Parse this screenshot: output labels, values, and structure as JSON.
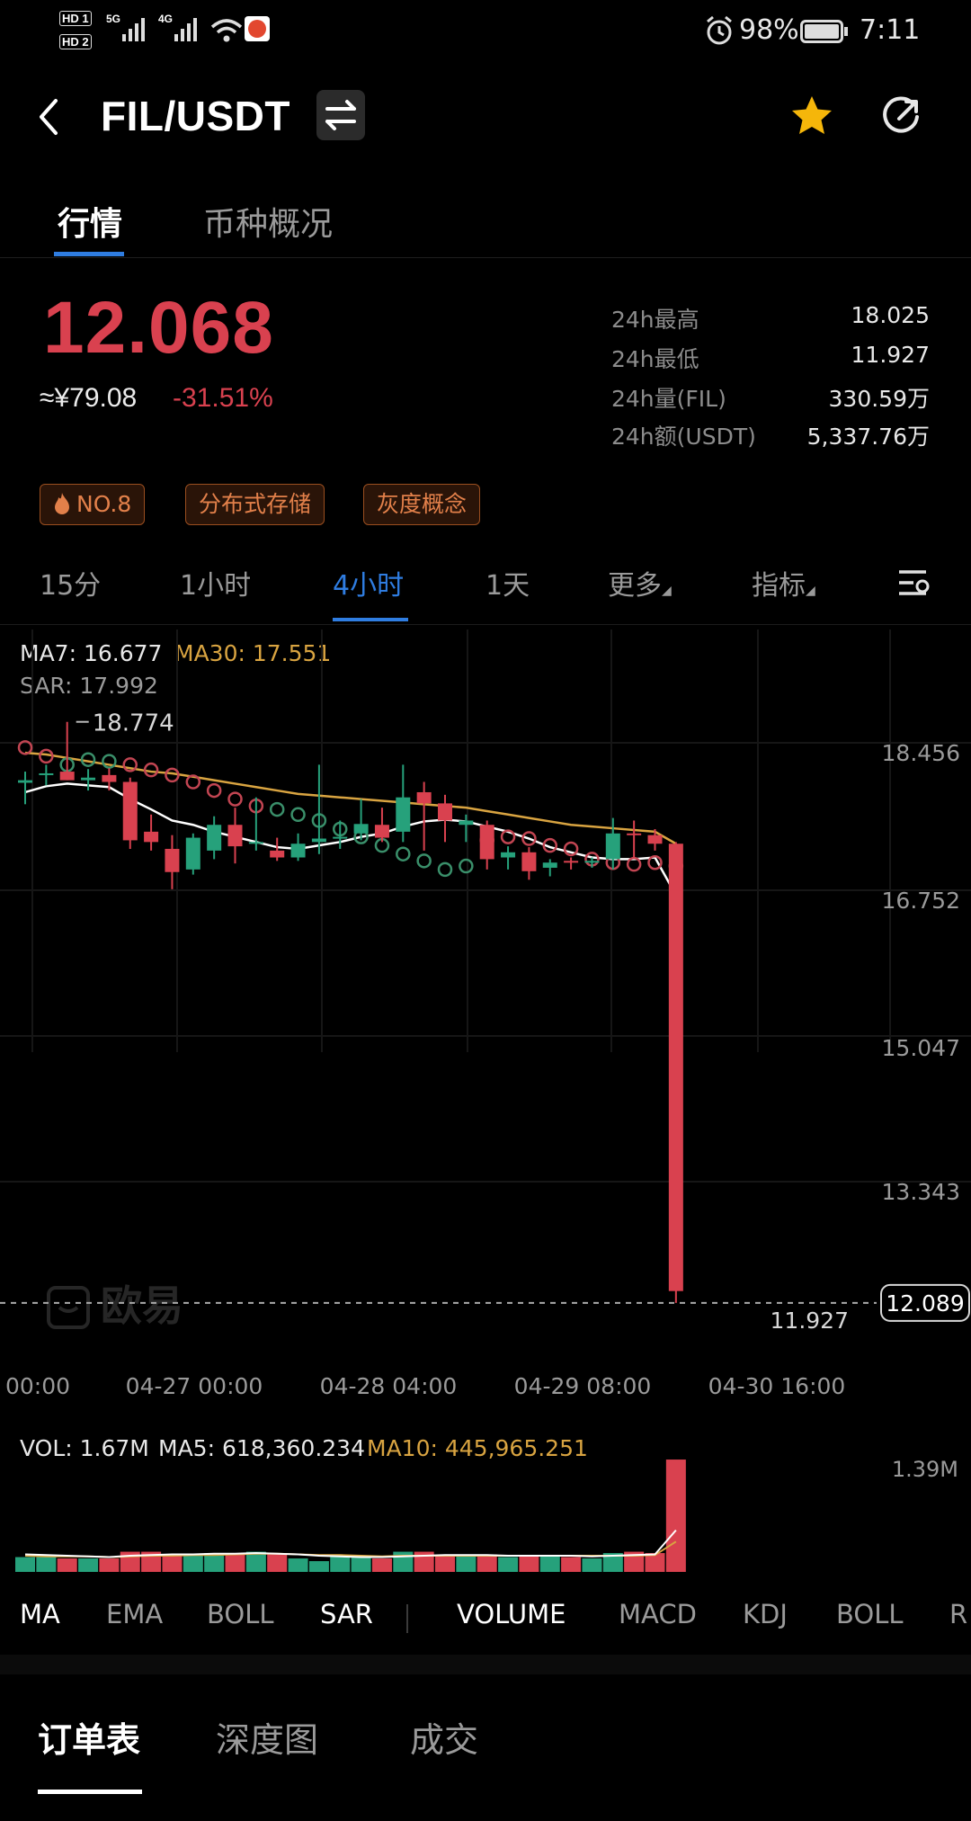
{
  "status_bar": {
    "sim1": "HD 1",
    "sim2": "HD 2",
    "net1": "5G",
    "net2": "4G",
    "battery": "98%",
    "time": "7:11",
    "icons": [
      "signal-icon",
      "wifi-icon",
      "app-notification-icon",
      "alarm-icon",
      "battery-icon"
    ]
  },
  "header": {
    "pair": "FIL/USDT",
    "icons": [
      "back-icon",
      "swap-icon",
      "star-icon",
      "share-icon"
    ]
  },
  "page_tabs": [
    {
      "label": "行情",
      "active": true
    },
    {
      "label": "币种概况",
      "active": false
    }
  ],
  "ticker": {
    "price": "12.068",
    "cny": "≈¥79.08",
    "change": "-31.51%"
  },
  "stats": [
    {
      "label": "24h最高",
      "value": "18.025"
    },
    {
      "label": "24h最低",
      "value": "11.927"
    },
    {
      "label": "24h量(FIL)",
      "value": "330.59万"
    },
    {
      "label": "24h额(USDT)",
      "value": "5,337.76万"
    }
  ],
  "tags": [
    "NO.8",
    "分布式存储",
    "灰度概念"
  ],
  "timeframes": [
    {
      "label": "15分"
    },
    {
      "label": "1小时"
    },
    {
      "label": "4小时",
      "active": true
    },
    {
      "label": "1天"
    },
    {
      "label": "更多"
    },
    {
      "label": "指标"
    }
  ],
  "indicators_top": {
    "ma7": "MA7: 16.677",
    "ma30": "MA30: 17.551",
    "sar": "SAR: 17.992"
  },
  "indicators_vol": {
    "vol": "VOL: 1.67M",
    "ma5": "MA5: 618,360.234",
    "ma10": "MA10: 445,965.251"
  },
  "indicator_tabs": [
    "MA",
    "EMA",
    "BOLL",
    "SAR",
    "VOLUME",
    "MACD",
    "KDJ",
    "BOLL",
    "R"
  ],
  "bottom_tabs": [
    "订单表",
    "深度图",
    "成交"
  ],
  "watermark": "欧易",
  "colors": {
    "up": "#26a17b",
    "down": "#d9414f",
    "accent": "#2f7de1",
    "ma30": "#d9a441",
    "ma7": "#ffffff"
  },
  "chart_data": {
    "type": "candlestick",
    "y_ticks": [
      "18.456",
      "16.752",
      "15.047",
      "13.343"
    ],
    "ylim": [
      11.9,
      18.85
    ],
    "x_ticks": [
      "00:00",
      "04-27 00:00",
      "04-28 04:00",
      "04-29 08:00",
      "04-30 16:00"
    ],
    "max_label": "18.774",
    "min_label": "11.927",
    "last_price_label": "12.089",
    "candles": [
      {
        "o": 17.99,
        "h": 18.12,
        "l": 17.74,
        "c": 18.02
      },
      {
        "o": 18.08,
        "h": 18.2,
        "l": 17.96,
        "c": 18.1
      },
      {
        "o": 18.12,
        "h": 18.7,
        "l": 18.02,
        "c": 18.02
      },
      {
        "o": 18.02,
        "h": 18.15,
        "l": 17.9,
        "c": 18.05
      },
      {
        "o": 18.08,
        "h": 18.16,
        "l": 17.9,
        "c": 18.0
      },
      {
        "o": 18.0,
        "h": 18.05,
        "l": 17.22,
        "c": 17.32
      },
      {
        "o": 17.42,
        "h": 17.62,
        "l": 17.2,
        "c": 17.3
      },
      {
        "o": 17.22,
        "h": 17.38,
        "l": 16.75,
        "c": 16.95
      },
      {
        "o": 16.98,
        "h": 17.4,
        "l": 16.92,
        "c": 17.35
      },
      {
        "o": 17.2,
        "h": 17.6,
        "l": 17.1,
        "c": 17.5
      },
      {
        "o": 17.5,
        "h": 17.7,
        "l": 17.05,
        "c": 17.25
      },
      {
        "o": 17.3,
        "h": 17.82,
        "l": 17.2,
        "c": 17.3
      },
      {
        "o": 17.2,
        "h": 17.35,
        "l": 17.08,
        "c": 17.12
      },
      {
        "o": 17.12,
        "h": 17.4,
        "l": 17.08,
        "c": 17.28
      },
      {
        "o": 17.3,
        "h": 18.2,
        "l": 17.16,
        "c": 17.34
      },
      {
        "o": 17.34,
        "h": 17.55,
        "l": 17.22,
        "c": 17.36
      },
      {
        "o": 17.4,
        "h": 17.8,
        "l": 17.32,
        "c": 17.51
      },
      {
        "o": 17.5,
        "h": 17.7,
        "l": 17.3,
        "c": 17.35
      },
      {
        "o": 17.42,
        "h": 18.2,
        "l": 17.3,
        "c": 17.82
      },
      {
        "o": 17.88,
        "h": 18.0,
        "l": 17.2,
        "c": 17.75
      },
      {
        "o": 17.75,
        "h": 17.85,
        "l": 17.3,
        "c": 17.55
      },
      {
        "o": 17.5,
        "h": 17.62,
        "l": 17.3,
        "c": 17.55
      },
      {
        "o": 17.5,
        "h": 17.55,
        "l": 16.98,
        "c": 17.1
      },
      {
        "o": 17.12,
        "h": 17.25,
        "l": 16.98,
        "c": 17.18
      },
      {
        "o": 17.18,
        "h": 17.24,
        "l": 16.86,
        "c": 16.96
      },
      {
        "o": 17.0,
        "h": 17.1,
        "l": 16.9,
        "c": 17.06
      },
      {
        "o": 17.08,
        "h": 17.12,
        "l": 16.98,
        "c": 17.06
      },
      {
        "o": 17.06,
        "h": 17.12,
        "l": 17.0,
        "c": 17.08
      },
      {
        "o": 17.1,
        "h": 17.58,
        "l": 16.98,
        "c": 17.4
      },
      {
        "o": 17.4,
        "h": 17.55,
        "l": 17.1,
        "c": 17.38
      },
      {
        "o": 17.38,
        "h": 17.45,
        "l": 17.2,
        "c": 17.28
      },
      {
        "o": 17.28,
        "h": 17.3,
        "l": 11.93,
        "c": 12.068
      }
    ],
    "ma7": [
      17.88,
      17.95,
      17.98,
      17.96,
      17.94,
      17.8,
      17.68,
      17.55,
      17.5,
      17.42,
      17.36,
      17.3,
      17.24,
      17.22,
      17.26,
      17.3,
      17.36,
      17.4,
      17.48,
      17.54,
      17.56,
      17.54,
      17.48,
      17.42,
      17.34,
      17.24,
      17.18,
      17.12,
      17.1,
      17.1,
      17.12,
      16.68
    ],
    "ma30": [
      18.34,
      18.32,
      18.28,
      18.24,
      18.2,
      18.16,
      18.12,
      18.1,
      18.06,
      18.02,
      17.98,
      17.94,
      17.9,
      17.86,
      17.84,
      17.82,
      17.8,
      17.78,
      17.76,
      17.74,
      17.72,
      17.7,
      17.66,
      17.62,
      17.58,
      17.54,
      17.5,
      17.48,
      17.46,
      17.44,
      17.42,
      17.28
    ],
    "sar": [
      18.4,
      18.3,
      18.2,
      18.26,
      18.24,
      18.2,
      18.14,
      18.08,
      18.0,
      17.9,
      17.8,
      17.72,
      17.68,
      17.62,
      17.55,
      17.45,
      17.36,
      17.26,
      17.16,
      17.08,
      16.98,
      17.02,
      17.32,
      17.36,
      17.34,
      17.26,
      17.22,
      17.1,
      17.06,
      17.04,
      17.06,
      17.02
    ],
    "sar_up": [
      false,
      false,
      true,
      true,
      true,
      false,
      false,
      false,
      false,
      false,
      false,
      false,
      true,
      true,
      true,
      true,
      true,
      true,
      true,
      true,
      true,
      true,
      false,
      false,
      false,
      false,
      false,
      false,
      false,
      false,
      false,
      false
    ],
    "volume": {
      "values": [
        0.22,
        0.22,
        0.2,
        0.2,
        0.2,
        0.3,
        0.3,
        0.26,
        0.24,
        0.28,
        0.26,
        0.3,
        0.26,
        0.2,
        0.16,
        0.24,
        0.22,
        0.2,
        0.3,
        0.3,
        0.24,
        0.24,
        0.26,
        0.22,
        0.24,
        0.24,
        0.22,
        0.2,
        0.28,
        0.3,
        0.28,
        1.67
      ],
      "ylim": [
        0,
        1.6
      ],
      "y_tick": "1.39M"
    }
  }
}
